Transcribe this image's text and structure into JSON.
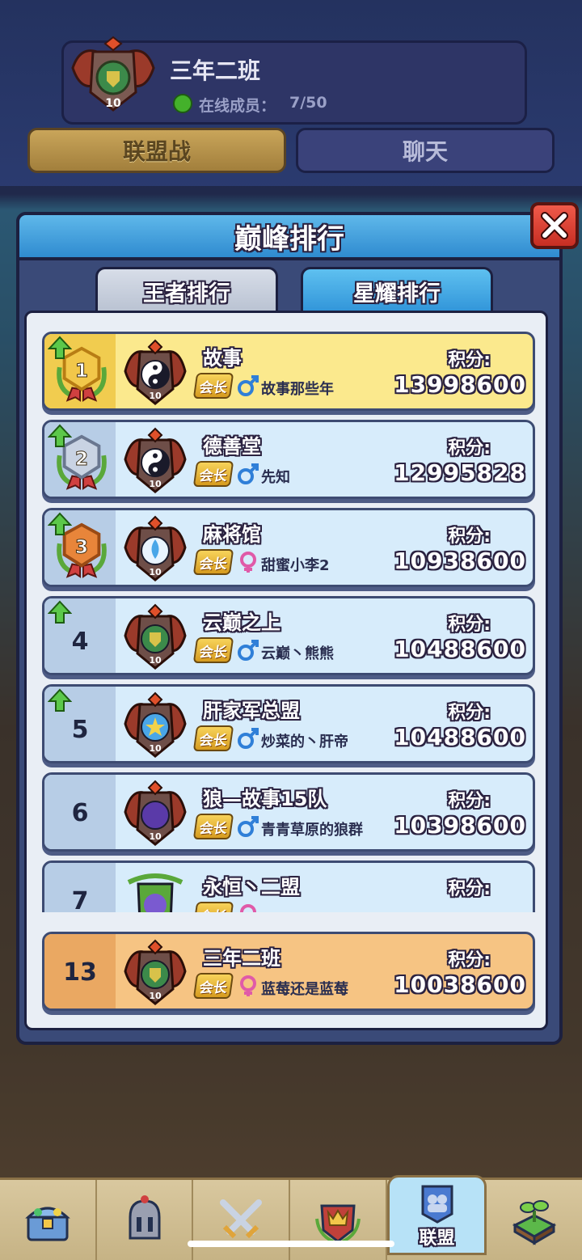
{
  "guild": {
    "name": "三年二班",
    "level": "10",
    "online_label": "在线成员：",
    "online_value": "7/50"
  },
  "top_tabs": [
    {
      "label": "联盟战",
      "active": true
    },
    {
      "label": "聊天",
      "active": false
    }
  ],
  "modal": {
    "title": "巅峰排行",
    "subtabs": [
      {
        "label": "王者排行",
        "active": false
      },
      {
        "label": "星耀排行",
        "active": true
      }
    ]
  },
  "score_label": "积分:",
  "leader_badge": "会长",
  "rankings": [
    {
      "rank": "1",
      "name": "故事",
      "leader": "故事那些年",
      "gender": "male",
      "score": "13998600",
      "rising": true,
      "emblem": "yin-yang",
      "level": "10"
    },
    {
      "rank": "2",
      "name": "德善堂",
      "leader": "先知",
      "gender": "male",
      "score": "12995828",
      "rising": true,
      "emblem": "yin-yang",
      "level": "10"
    },
    {
      "rank": "3",
      "name": "麻将馆",
      "leader": "甜蜜小李2",
      "gender": "female",
      "score": "10938600",
      "rising": true,
      "emblem": "water-drop",
      "level": "10"
    },
    {
      "rank": "4",
      "name": "云巅之上",
      "leader": "云巅丶熊熊",
      "gender": "male",
      "score": "10488600",
      "rising": true,
      "emblem": "shield",
      "level": "10"
    },
    {
      "rank": "5",
      "name": "肝家军总盟",
      "leader": "炒菜的丶肝帝",
      "gender": "male",
      "score": "10488600",
      "rising": true,
      "emblem": "star",
      "level": "10"
    },
    {
      "rank": "6",
      "name": "狼—故事15队",
      "leader": "青青草原的狼群",
      "gender": "male",
      "score": "10398600",
      "rising": false,
      "emblem": "moon",
      "level": "10"
    },
    {
      "rank": "7",
      "name": "永恒丶二盟",
      "leader": "",
      "gender": "female",
      "score": "",
      "rising": false,
      "emblem": "feather",
      "level": ""
    }
  ],
  "self_row": {
    "rank": "13",
    "name": "三年二班",
    "leader": "蓝莓还是蓝莓",
    "gender": "female",
    "score": "10038600",
    "emblem": "shield",
    "level": "10"
  },
  "bottom_nav": [
    {
      "icon": "treasure-chest-icon",
      "label": ""
    },
    {
      "icon": "knight-helmet-icon",
      "label": ""
    },
    {
      "icon": "crossed-swords-icon",
      "label": ""
    },
    {
      "icon": "crown-shield-icon",
      "label": ""
    },
    {
      "icon": "alliance-banner-icon",
      "label": "联盟",
      "active": true
    },
    {
      "icon": "sprout-block-icon",
      "label": ""
    }
  ],
  "colors": {
    "row_default": "#d7ecfb",
    "row_first": "#fbe98d",
    "row_self": "#f6c483",
    "male": "#2f7fd8",
    "female": "#e05aa8",
    "accent_blue": "#2f93d8"
  }
}
